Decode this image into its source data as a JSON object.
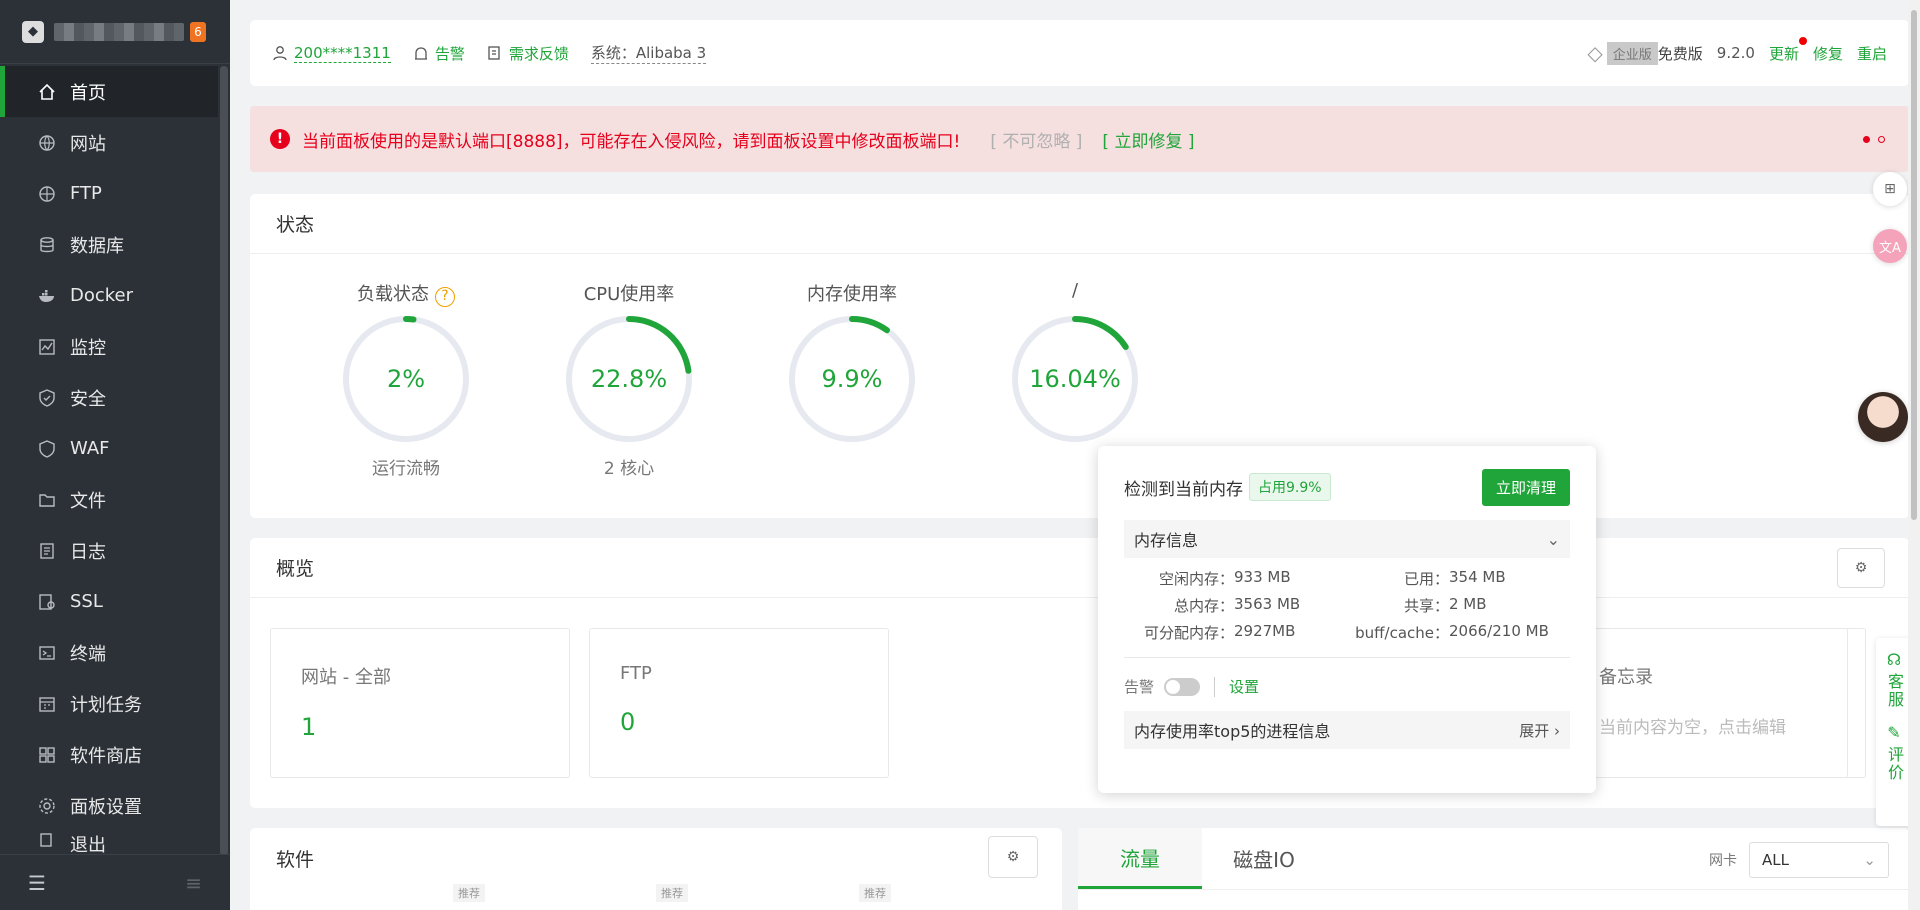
{
  "sidebar": {
    "badge": "6",
    "items": [
      {
        "label": "首页",
        "icon": "home-icon"
      },
      {
        "label": "网站",
        "icon": "globe-icon"
      },
      {
        "label": "FTP",
        "icon": "ftp-icon"
      },
      {
        "label": "数据库",
        "icon": "database-icon"
      },
      {
        "label": "Docker",
        "icon": "docker-icon"
      },
      {
        "label": "监控",
        "icon": "monitor-icon"
      },
      {
        "label": "安全",
        "icon": "shield-icon"
      },
      {
        "label": "WAF",
        "icon": "waf-icon"
      },
      {
        "label": "文件",
        "icon": "folder-icon"
      },
      {
        "label": "日志",
        "icon": "log-icon"
      },
      {
        "label": "SSL",
        "icon": "ssl-icon"
      },
      {
        "label": "终端",
        "icon": "terminal-icon"
      },
      {
        "label": "计划任务",
        "icon": "calendar-icon"
      },
      {
        "label": "软件商店",
        "icon": "apps-icon"
      },
      {
        "label": "面板设置",
        "icon": "gear-icon"
      },
      {
        "label": "退出",
        "icon": "logout-icon"
      }
    ]
  },
  "topbar": {
    "user": "200****1311",
    "alarm": "告警",
    "feedback": "需求反馈",
    "system": "系统：Alibaba 3",
    "enterprise": "企业版",
    "free": "免费版",
    "version": "9.2.0",
    "update": "更新",
    "repair": "修复",
    "restart": "重启"
  },
  "alert": {
    "message": "当前面板使用的是默认端口[8888]，可能存在入侵风险，请到面板设置中修改面板端口!",
    "ignore": "[ 不可忽略 ]",
    "fix": "[ 立即修复 ]"
  },
  "status": {
    "title": "状态",
    "gauges": [
      {
        "label": "负载状态",
        "value": "2%",
        "sub": "运行流畅",
        "percent": 2
      },
      {
        "label": "CPU使用率",
        "value": "22.8%",
        "sub": "2 核心",
        "percent": 22.8
      },
      {
        "label": "内存使用率",
        "value": "9.9%",
        "sub": "",
        "percent": 9.9
      },
      {
        "label": "/",
        "value": "16.04%",
        "sub": "",
        "percent": 16.04
      }
    ]
  },
  "overview": {
    "title": "概览",
    "boxes": [
      {
        "label": "网站 - 全部",
        "value": "1"
      },
      {
        "label": "FTP",
        "value": "0"
      }
    ],
    "memo": {
      "label": "备忘录",
      "placeholder": "当前内容为空，点击编辑"
    }
  },
  "software": {
    "title": "软件",
    "rec": "推荐"
  },
  "traffic": {
    "tab1": "流量",
    "tab2": "磁盘IO",
    "nic_label": "网卡",
    "nic_value": "ALL"
  },
  "popup": {
    "title": "检测到当前内存",
    "tag": "占用9.9%",
    "button": "立即清理",
    "section": "内存信息",
    "free_k": "空闲内存：",
    "free_v": "933 MB",
    "used_k": "已用：",
    "used_v": "354 MB",
    "total_k": "总内存：",
    "total_v": "3563 MB",
    "shared_k": "共享：",
    "shared_v": "2 MB",
    "avail_k": "可分配内存：",
    "avail_v": "2927MB",
    "buff_k": "buff/cache：",
    "buff_v": "2066/210 MB",
    "alarm": "告警",
    "settings": "设置",
    "top5": "内存使用率top5的进程信息",
    "expand": "展开"
  },
  "float": {
    "service": "客服",
    "review": "评价"
  },
  "colors": {
    "accent": "#20a53a",
    "danger": "#e6001c",
    "sidebar": "#2c3138"
  }
}
